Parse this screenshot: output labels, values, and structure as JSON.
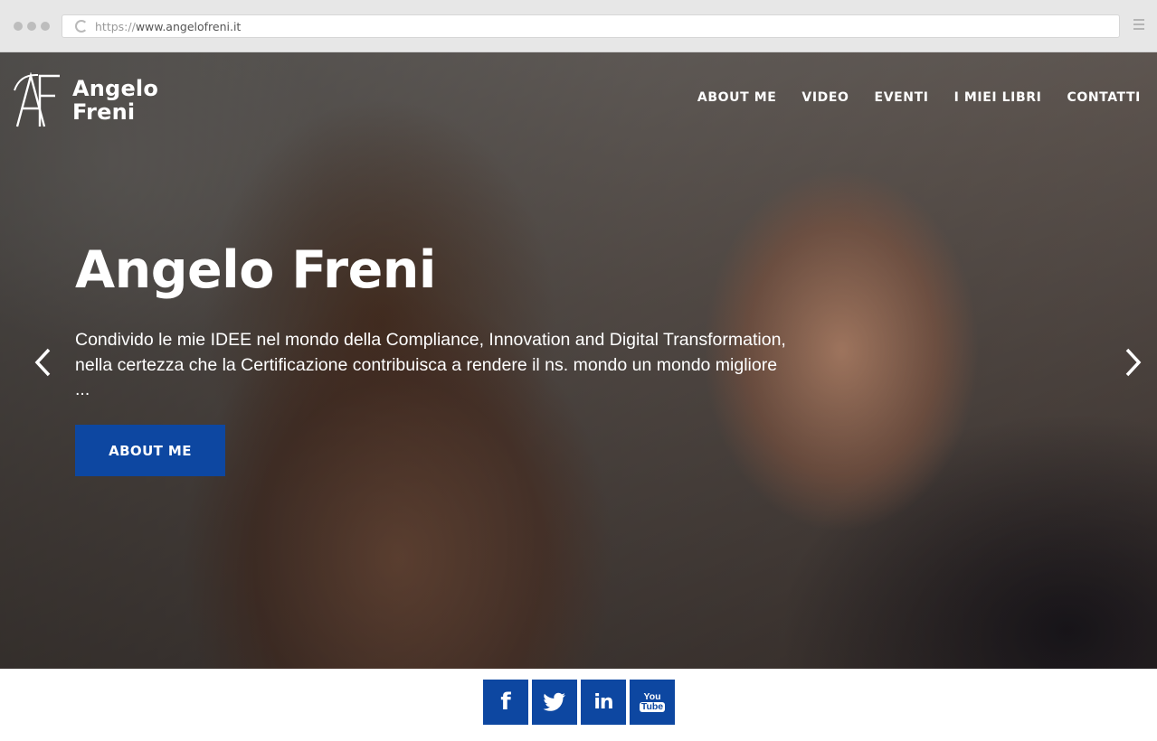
{
  "browser": {
    "url_protocol": "https://",
    "url_host": "www.angelofreni.it"
  },
  "header": {
    "logo_line1": "Angelo",
    "logo_line2": "Freni",
    "nav": [
      "ABOUT ME",
      "VIDEO",
      "EVENTI",
      "I MIEI LIBRI",
      "CONTATTI"
    ]
  },
  "hero": {
    "title": "Angelo Freni",
    "description_line1": "Condivido le mie IDEE nel mondo della Compliance, Innovation and Digital Transformation,",
    "description_line2": "nella certezza che la Certificazione contribuisca a rendere il ns. mondo un mondo migliore",
    "description_line3": "...",
    "button_label": "ABOUT ME",
    "prev_icon": "chevron-left-icon",
    "next_icon": "chevron-right-icon"
  },
  "social": {
    "facebook": "f",
    "linkedin": "in",
    "youtube_top": "You",
    "youtube_bottom": "Tube"
  },
  "colors": {
    "accent": "#0d47a1",
    "chrome": "#e7e7e7",
    "text_on_hero": "#ffffff"
  }
}
